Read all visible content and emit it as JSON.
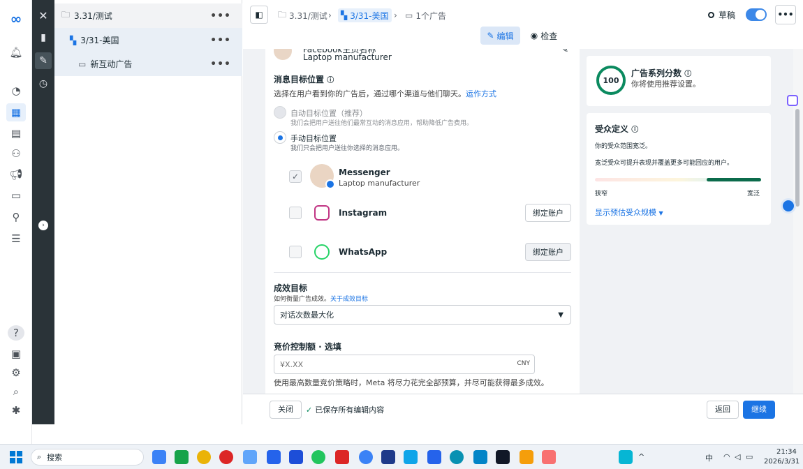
{
  "tree": {
    "campaign": "3.31/测试",
    "adset": "3/31-美国",
    "ad": "新互动广告",
    "more": "•••"
  },
  "top": {
    "crumb1": "3.31/测试",
    "crumb2": "3/31-美国",
    "crumb3": "1个广告",
    "status": "草稿",
    "edit": "编辑",
    "review": "检查",
    "more": "•••"
  },
  "ad": {
    "page_name_partial": "Facebook主页名称",
    "page_sub": "Laptop manufacturer"
  },
  "dest": {
    "title": "消息目标位置",
    "desc": "选择在用户看到你的广告后，通过哪个渠道与他们聊天。",
    "how": "运作方式",
    "auto": "自动目标位置（推荐）",
    "auto_desc": "我们会把用户送往他们最常互动的消息应用，帮助降低广告费用。",
    "manual": "手动目标位置",
    "manual_desc": "我们只会把用户送往你选择的消息应用。"
  },
  "channels": [
    {
      "name": "Messenger",
      "sub": "Laptop manufacturer"
    },
    {
      "name": "Instagram",
      "btn": "绑定账户"
    },
    {
      "name": "WhatsApp",
      "btn": "绑定账户"
    }
  ],
  "goal": {
    "title": "成效目标",
    "desc": "如何衡量广告成效。",
    "link": "关于成效目标",
    "value": "对话次数最大化"
  },
  "bid": {
    "title": "竞价控制额 · 选填",
    "placeholder": "¥X.XX",
    "currency": "CNY",
    "note": "使用最高数量竞价策略时，Meta 将尽力花完全部预算，并尽可能获得最多成效。"
  },
  "score": {
    "value": "100",
    "title": "广告系列分数",
    "sub": "你将使用推荐设置。"
  },
  "audience": {
    "title": "受众定义",
    "line1": "你的受众范围宽泛。",
    "line2": "宽泛受众可提升表现并覆盖更多可能回应的用户。",
    "narrow": "狭窄",
    "broad": "宽泛",
    "link": "显示预估受众规模"
  },
  "bottom": {
    "close": "关闭",
    "saved": "已保存所有编辑内容",
    "back": "返回",
    "continue": "继续"
  },
  "taskbar": {
    "search": "搜索",
    "time": "21:34",
    "date": "2026/3/31",
    "lang": "中"
  },
  "colors": {
    "accent": "#1b74e4",
    "green": "#0b8a5f",
    "dark": "#2a3338"
  }
}
